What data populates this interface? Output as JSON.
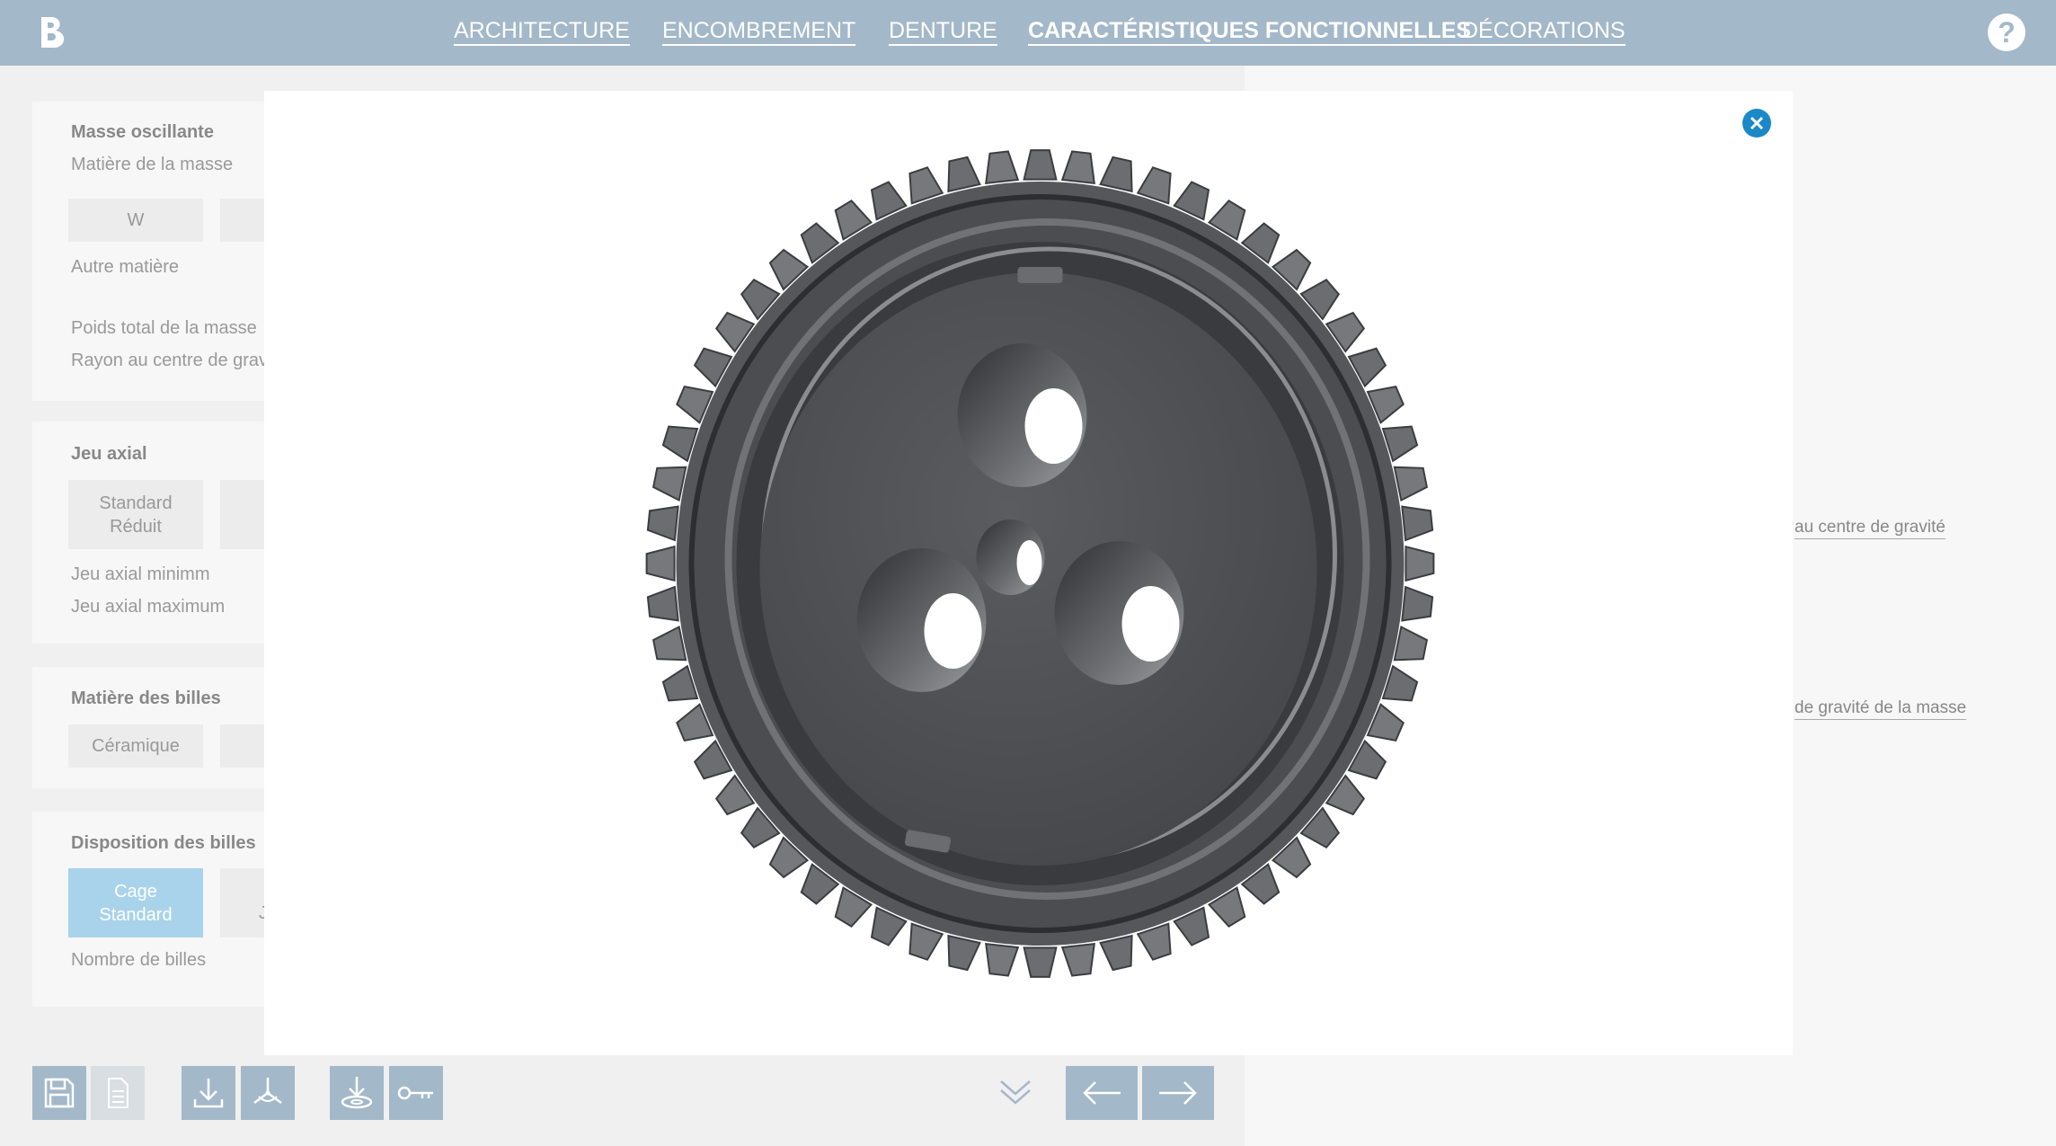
{
  "nav": {
    "items": [
      {
        "label": "ARCHITECTURE",
        "active": false
      },
      {
        "label": "ENCOMBREMENT",
        "active": false
      },
      {
        "label": "DENTURE",
        "active": false
      },
      {
        "label": "CARACTÉRISTIQUES FONCTIONNELLES",
        "active": true
      },
      {
        "label": "DÉCORATIONS",
        "active": false
      }
    ],
    "help_label": "?"
  },
  "cards": {
    "masse": {
      "title": "Masse oscillante",
      "material_label": "Matière de la masse",
      "option_w": "W",
      "other_label": "Autre matière",
      "poids_label": "Poids total de la masse",
      "rayon_label": "Rayon au centre de gravité"
    },
    "jeu": {
      "title": "Jeu axial",
      "option_standard_line1": "Standard",
      "option_standard_line2": "Réduit",
      "min_label": "Jeu axial minimm",
      "max_label": "Jeu axial maximum"
    },
    "billes": {
      "title": "Matière des billes",
      "option_ceramique": "Céramique"
    },
    "disposition": {
      "title": "Disposition des billes",
      "option_cage_line1": "Cage",
      "option_cage_line2": "Standard",
      "option_partial": "Jo",
      "nombre_label": "Nombre de billes"
    }
  },
  "right_panel": {
    "link1": "au centre de gravité",
    "link2": "de gravité de la masse"
  },
  "toolbar": {
    "save_icon": "save-icon",
    "document_icon": "document-icon",
    "download_icon": "download-icon",
    "axes_icon": "3d-axes-icon",
    "download_drop_icon": "download-platter-icon",
    "key_icon": "key-icon",
    "chevron_icon": "double-chevron-down-icon",
    "prev_icon": "arrow-left-icon",
    "next_icon": "arrow-right-icon"
  },
  "colors": {
    "nav_bg": "#a3b8c9",
    "accent": "#1b88c7",
    "selected_option": "#a8d3ea"
  }
}
